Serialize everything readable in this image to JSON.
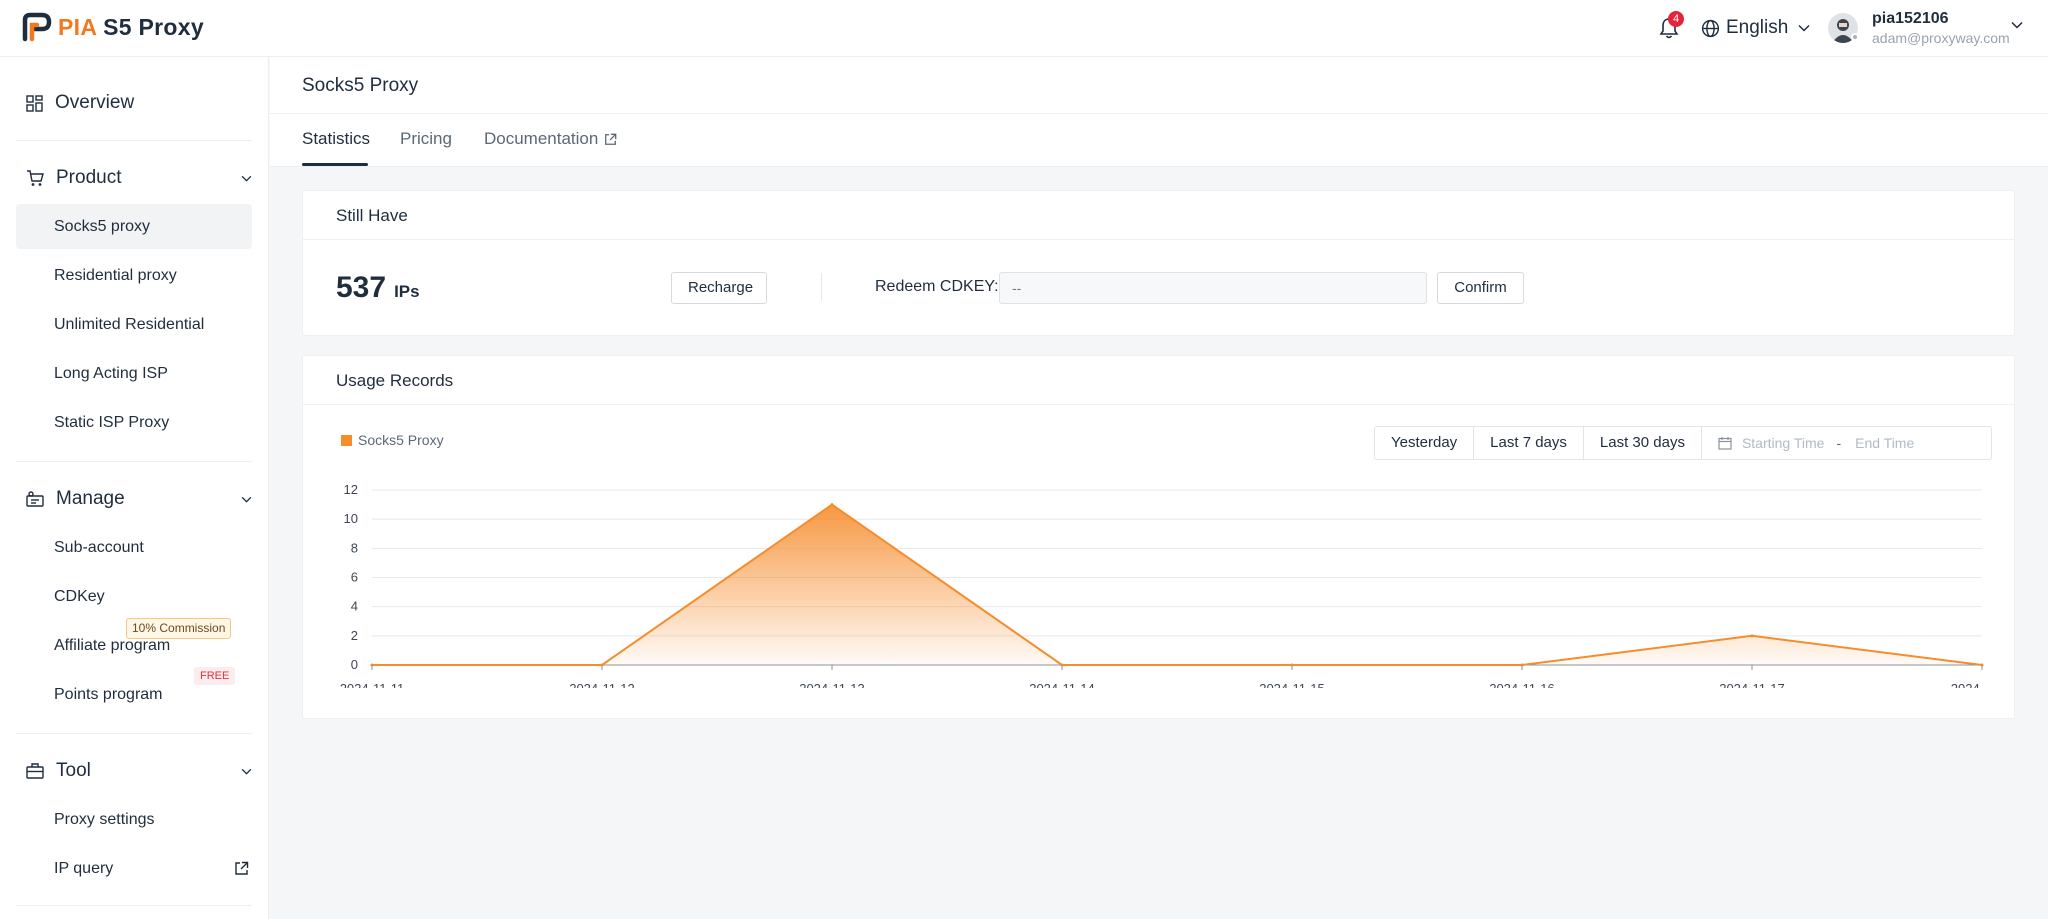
{
  "brand": {
    "pia": "PIA",
    "rest": "S5 Proxy"
  },
  "header": {
    "notifications_count": "4",
    "language": "English",
    "user_name": "pia152106",
    "user_email": "adam@proxyway.com"
  },
  "sidebar": {
    "overview": "Overview",
    "product": {
      "label": "Product",
      "items": [
        "Socks5 proxy",
        "Residential proxy",
        "Unlimited Residential",
        "Long Acting ISP",
        "Static ISP Proxy"
      ]
    },
    "manage": {
      "label": "Manage",
      "items": [
        "Sub-account",
        "CDKey",
        "Affiliate program",
        "Points program"
      ],
      "commission_tag": "10% Commission",
      "free_tag": "FREE"
    },
    "tool": {
      "label": "Tool",
      "items": [
        "Proxy settings",
        "IP query"
      ]
    }
  },
  "page": {
    "title": "Socks5 Proxy",
    "tabs": [
      "Statistics",
      "Pricing",
      "Documentation"
    ]
  },
  "still_have": {
    "title": "Still Have",
    "count": "537",
    "unit": "IPs",
    "recharge": "Recharge",
    "redeem_label": "Redeem CDKEY:",
    "redeem_placeholder": "--",
    "confirm": "Confirm"
  },
  "usage": {
    "title": "Usage Records",
    "ranges": [
      "Yesterday",
      "Last 7 days",
      "Last 30 days"
    ],
    "start_placeholder": "Starting Time",
    "date_sep": "-",
    "end_placeholder": "End Time"
  },
  "chart_data": {
    "type": "area",
    "x": [
      "2024-11-11",
      "2024-11-12",
      "2024-11-13",
      "2024-11-14",
      "2024-11-15",
      "2024-11-16",
      "2024-11-17",
      "2024-"
    ],
    "series": [
      {
        "name": "Socks5 Proxy",
        "values": [
          0,
          0,
          11,
          0,
          0,
          0,
          2,
          0
        ],
        "color": "#f68c2c"
      }
    ],
    "ylim": [
      0,
      12
    ],
    "yticks": [
      0,
      2,
      4,
      6,
      8,
      10,
      12
    ],
    "grid": true,
    "legend": "top-left"
  }
}
